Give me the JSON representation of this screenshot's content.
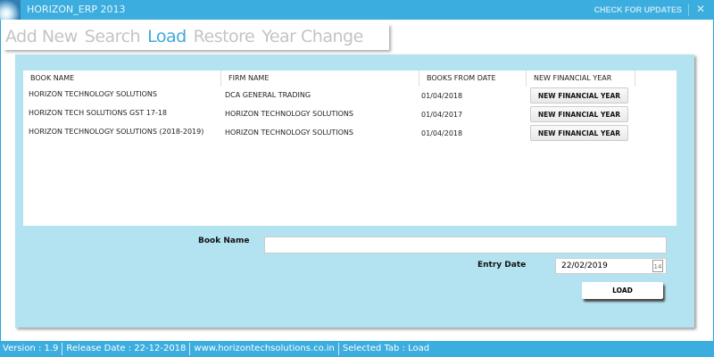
{
  "app": {
    "title": "HORIZON_ERP 2013",
    "check_updates": "CHECK FOR UPDATES",
    "close": "✕"
  },
  "tabs": [
    {
      "label": "Add New"
    },
    {
      "label": "Search"
    },
    {
      "label": "Load",
      "active": true
    },
    {
      "label": "Restore"
    },
    {
      "label": "Year Change"
    }
  ],
  "grid": {
    "headers": [
      "BOOK NAME",
      "FIRM NAME",
      "BOOKS FROM DATE",
      "NEW FINANCIAL YEAR"
    ],
    "rows": [
      {
        "book": "HORIZON TECHNOLOGY SOLUTIONS",
        "firm": "DCA GENERAL TRADING",
        "date": "01/04/2018",
        "action": "NEW FINANCIAL YEAR"
      },
      {
        "book": "HORIZON TECH SOLUTIONS GST 17-18",
        "firm": "HORIZON TECHNOLOGY SOLUTIONS",
        "date": "01/04/2017",
        "action": "NEW FINANCIAL YEAR"
      },
      {
        "book": "HORIZON TECHNOLOGY SOLUTIONS (2018-2019)",
        "firm": "HORIZON TECHNOLOGY SOLUTIONS",
        "date": "01/04/2018",
        "action": "NEW FINANCIAL YEAR"
      }
    ]
  },
  "form": {
    "book_name_label": "Book Name",
    "book_name_value": "",
    "entry_date_label": "Entry Date",
    "entry_date_value": "22/02/2019",
    "calendar_day": "14",
    "load_label": "LOAD"
  },
  "status": {
    "version": "Version : 1.9",
    "release": "Release Date : 22-12-2018",
    "website": "www.horizontechsolutions.co.in",
    "selected_tab": "Selected Tab :  Load"
  },
  "colors": {
    "accent": "#3badde",
    "panel": "#b3e3f1",
    "active_tab": "#3fa9de"
  }
}
